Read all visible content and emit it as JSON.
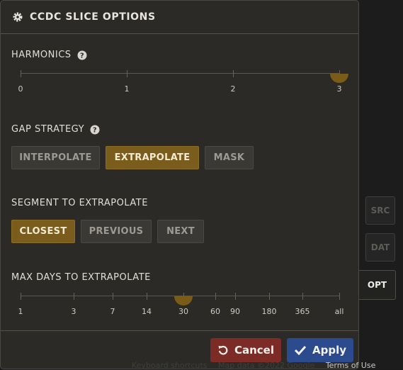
{
  "panel": {
    "title": "CCDC SLICE OPTIONS",
    "title_icon": "gear-icon"
  },
  "harmonics": {
    "label": "HARMONICS",
    "help_icon": "help-icon",
    "ticks": [
      "0",
      "1",
      "2",
      "3"
    ],
    "value": "3"
  },
  "gap_strategy": {
    "label": "GAP STRATEGY",
    "help_icon": "help-icon",
    "options": [
      "INTERPOLATE",
      "EXTRAPOLATE",
      "MASK"
    ],
    "selected": "EXTRAPOLATE"
  },
  "segment": {
    "label": "SEGMENT TO EXTRAPOLATE",
    "options": [
      "CLOSEST",
      "PREVIOUS",
      "NEXT"
    ],
    "selected": "CLOSEST"
  },
  "max_days": {
    "label": "MAX DAYS TO EXTRAPOLATE",
    "ticks": [
      "1",
      "3",
      "7",
      "14",
      "30",
      "60",
      "90",
      "180",
      "365",
      "all"
    ],
    "value": "30"
  },
  "actions": {
    "cancel_label": "Cancel",
    "apply_label": "Apply"
  },
  "side_tabs": [
    "SRC",
    "DAT",
    "OPT"
  ],
  "active_tab": "OPT",
  "attribution": {
    "shortcuts": "Keyboard shortcuts",
    "map_data": "Map data ©2022 Google",
    "terms": "Terms of Use"
  },
  "colors": {
    "accent": "#7a5c1c",
    "cancel": "#7c2b26",
    "apply": "#2c4b8e",
    "panel_bg": "#2b2a26"
  }
}
